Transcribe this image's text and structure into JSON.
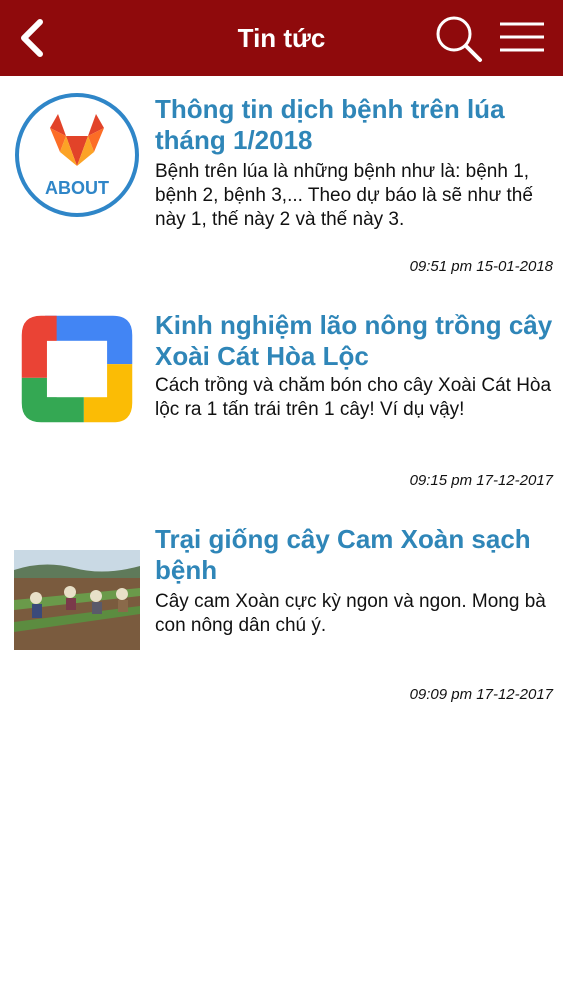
{
  "header": {
    "title": "Tin tức",
    "back_icon": "chevron-left-icon",
    "search_icon": "search-icon",
    "menu_icon": "hamburger-menu-icon",
    "bg_color": "#8f0a0c"
  },
  "articles": [
    {
      "title": "Thông tin dịch bệnh trên lúa tháng 1/2018",
      "description": "Bệnh trên lúa là những bệnh như là: bệnh 1, bệnh 2, bệnh 3,... Theo dự báo là sẽ như thế này 1, thế này 2 và thế này 3.",
      "date": "09:51 pm 15-01-2018",
      "thumb_text": "ABOUT",
      "thumb_icon": "fox-logo-icon"
    },
    {
      "title": "Kinh nghiệm lão nông trồng cây Xoài Cát Hòa Lộc",
      "description": "Cách trồng và chăm bón cho cây Xoài Cát Hòa lộc ra 1 tấn trái trên 1 cây! Ví dụ vậy!",
      "date": "09:15 pm 17-12-2017",
      "thumb_icon": "interlocking-ribbons-logo-icon"
    },
    {
      "title": "Trại giống cây Cam Xoàn sạch bệnh",
      "description": "Cây cam Xoàn cực kỳ ngon và ngon. Mong bà con nông dân chú ý.",
      "date": "09:09 pm 17-12-2017",
      "thumb_icon": "farmers-field-photo"
    }
  ],
  "colors": {
    "title_color": "#2f86b8",
    "text_color": "#111111"
  }
}
